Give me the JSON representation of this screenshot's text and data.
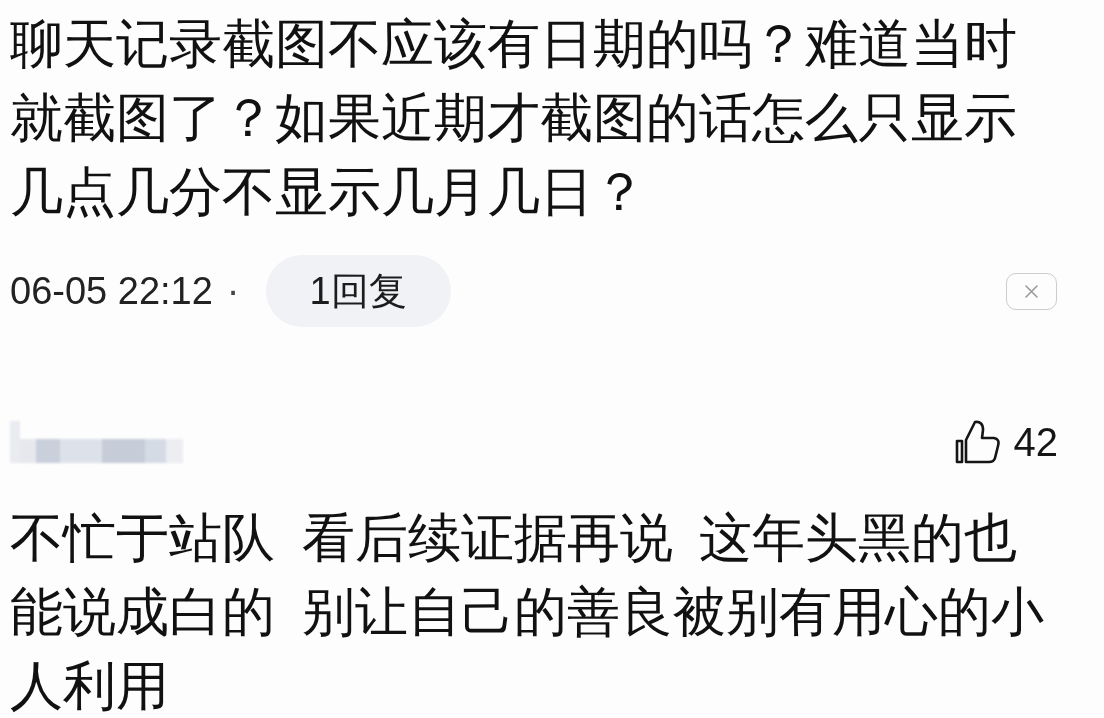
{
  "comments": [
    {
      "text": "聊天记录截图不应该有日期的吗？难道当时就截图了？如果近期才截图的话怎么只显示几点几分不显示几月几日？",
      "time": "06-05 22:12",
      "separator": "·",
      "replies": "1回复",
      "dismissible": true
    },
    {
      "author_hidden": true,
      "likes": "42",
      "text": "不忙于站队 看后续证据再说 这年头黑的也能说成白的 别让自己的善良被别有用心的小人利用"
    }
  ]
}
